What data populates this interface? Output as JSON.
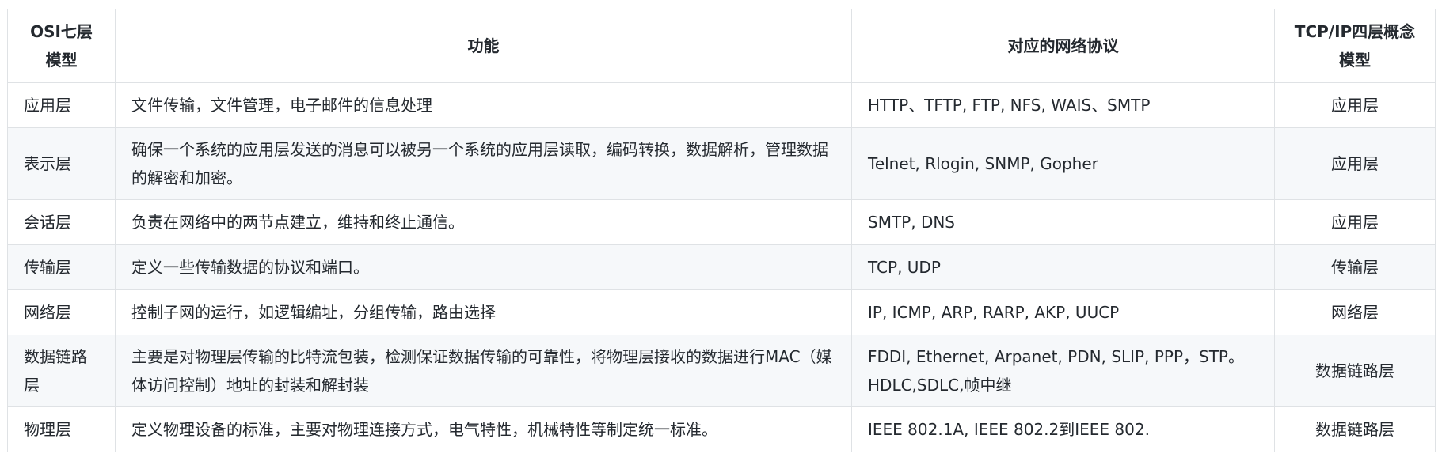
{
  "table": {
    "headers": [
      "OSI七层模型",
      "功能",
      "对应的网络协议",
      "TCP/IP四层概念模型"
    ],
    "rows": [
      [
        "应用层",
        "文件传输，文件管理，电子邮件的信息处理",
        "HTTP、TFTP, FTP, NFS, WAIS、SMTP",
        "应用层"
      ],
      [
        "表示层",
        "确保一个系统的应用层发送的消息可以被另一个系统的应用层读取，编码转换，数据解析，管理数据的解密和加密。",
        "Telnet, Rlogin, SNMP, Gopher",
        "应用层"
      ],
      [
        "会话层",
        "负责在网络中的两节点建立，维持和终止通信。",
        "SMTP, DNS",
        "应用层"
      ],
      [
        "传输层",
        "定义一些传输数据的协议和端口。",
        "TCP, UDP",
        "传输层"
      ],
      [
        "网络层",
        "控制子网的运行，如逻辑编址，分组传输，路由选择",
        "IP, ICMP, ARP, RARP, AKP, UUCP",
        "网络层"
      ],
      [
        "数据链路层",
        "主要是对物理层传输的比特流包装，检测保证数据传输的可靠性，将物理层接收的数据进行MAC（媒体访问控制）地址的封装和解封装",
        "FDDI, Ethernet, Arpanet, PDN, SLIP, PPP，STP。HDLC,SDLC,帧中继",
        "数据链路层"
      ],
      [
        "物理层",
        "定义物理设备的标准，主要对物理连接方式，电气特性，机械特性等制定统一标准。",
        "IEEE 802.1A, IEEE 802.2到IEEE 802.",
        "数据链路层"
      ]
    ]
  }
}
